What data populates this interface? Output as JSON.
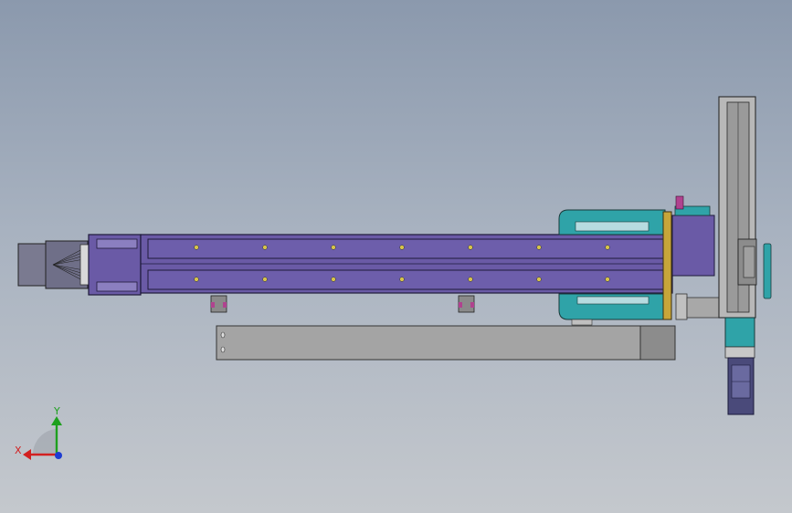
{
  "viewport": {
    "background_top": "#8b99ad",
    "background_bottom": "#c4c8cd"
  },
  "model": {
    "rail_color": "#6a5aa6",
    "rail_dark": "#3c3070",
    "bracket_color": "#2fa3a8",
    "plate_color": "#a4a4a4",
    "accent_yellow": "#c7a53a",
    "accent_magenta": "#b0428f",
    "motor_color": "#4a4a7a"
  },
  "triad": {
    "x_label": "X",
    "y_label": "Y",
    "x_color": "#d22020",
    "y_color": "#1ea01e",
    "z_color": "#1e3cd2"
  }
}
